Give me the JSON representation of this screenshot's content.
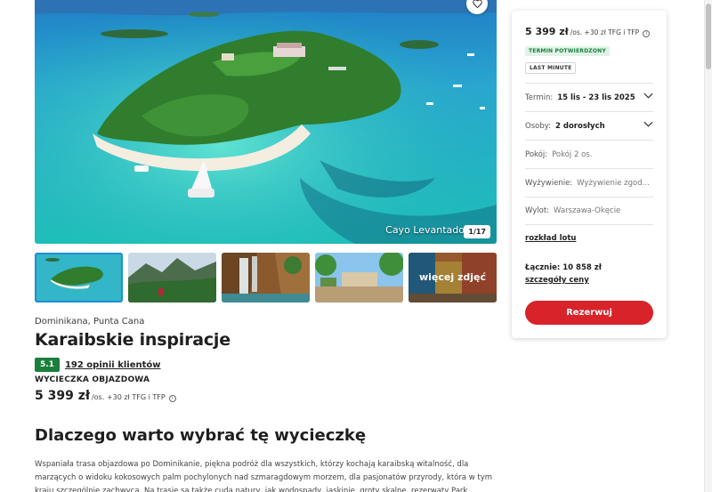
{
  "gallery": {
    "caption": "Cayo Levantado",
    "counter": "1/17",
    "favorite_icon": "heart-icon",
    "more_photos_label": "więcej zdjęć"
  },
  "trip": {
    "location": "Dominikana, Punta Cana",
    "title": "Karaibskie inspiracje",
    "rating": "5.1",
    "reviews": "192 opinii klientów",
    "type": "WYCIECZKA OBJAZDOWA",
    "price": "5 399 zł",
    "price_suffix": "/os. +30 zł TFG i TFP"
  },
  "section": {
    "title": "Dlaczego warto wybrać tę wycieczkę",
    "description": "Wspaniała trasa objazdowa po Dominikanie, piękna podróż dla wszystkich, którzy kochają karaibską witalność, dla marzących o widoku kokosowych palm pochylonych nad szmaragdowym morzem, dla pasjonatów przyrody, która w tym kraju szczególnie zachwyca. Na trasie są także cuda natury, jak wodospady, jaskinie, groty skalne, rezerwaty Park Narodowy Los Haitises, W..."
  },
  "booking": {
    "price": "5 399 zł",
    "price_suffix": "/os. +30 zł TFG i TFP",
    "tag_confirmed": "TERMIN POTWIERDZONY",
    "tag_last_minute": "LAST MINUTE",
    "term_label": "Termin:",
    "term_value": "15 lis - 23 lis 2025",
    "persons_label": "Osoby:",
    "persons_value": "2 dorosłych",
    "room_label": "Pokój:",
    "room_value": "Pokój 2 os.",
    "board_label": "Wyżywienie:",
    "board_value": "Wyżywienie zgodnie z programem",
    "departure_label": "Wylot:",
    "departure_value": "Warszawa-Okęcie",
    "flight_link": "rozkład lotu",
    "total": "Łącznie: 10 858 zł",
    "details_link": "szczegóły ceny",
    "book_button": "Rezerwuj"
  },
  "colors": {
    "accent_red": "#d8232a",
    "rating_green": "#1a7f3c",
    "active_thumb_border": "#1e8fd8"
  }
}
